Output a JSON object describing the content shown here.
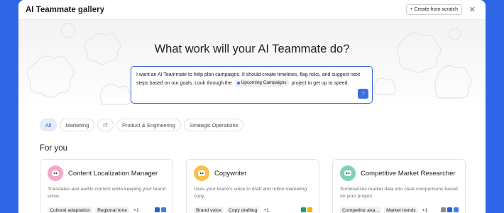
{
  "modal": {
    "title": "AI Teammate gallery",
    "create_button": "+ Create from scratch",
    "close_glyph": "✕"
  },
  "hero": {
    "headline": "What work will your AI Teammate do?",
    "prompt_before": "I want an AI Teammate to help plan campaigns. It should create timelines, flag risks, and suggest next steps based on our goals. Look through the",
    "prompt_chip": "Upcoming Campaigns",
    "prompt_after": "project to get up to speed.",
    "send_glyph": "↑"
  },
  "filters": [
    "All",
    "Marketing",
    "IT",
    "Product & Engineering",
    "Strategic Operations"
  ],
  "section_title": "For you",
  "cards": [
    {
      "name": "Content Localization Manager",
      "description": "Translates and audits content while keeping your brand voice.",
      "tags": [
        "Cultural adaptation",
        "Regional tone"
      ],
      "more": "+1",
      "avatar_color": "#f6a6c8",
      "icon": "robot-face-icon",
      "apps": [
        "#2b5fd6",
        "#3e7ee8"
      ]
    },
    {
      "name": "Copywriter",
      "description": "Uses your brand's voice to draft and refine marketing copy.",
      "tags": [
        "Brand voice",
        "Copy drafting"
      ],
      "more": "+1",
      "avatar_color": "#f5c24a",
      "icon": "robot-face-icon",
      "apps": [
        "#1aa260",
        "#f4b400"
      ]
    },
    {
      "name": "Competitive Market Researcher",
      "description": "Summarizes market data into clear comparisons based on your project.",
      "tags": [
        "Competitor ana...",
        "Market trends"
      ],
      "more": "+1",
      "avatar_color": "#7fd3b0",
      "icon": "robot-face-icon",
      "apps": [
        "#8a8b8d",
        "#2b5fd6",
        "#3e7ee8"
      ]
    }
  ]
}
